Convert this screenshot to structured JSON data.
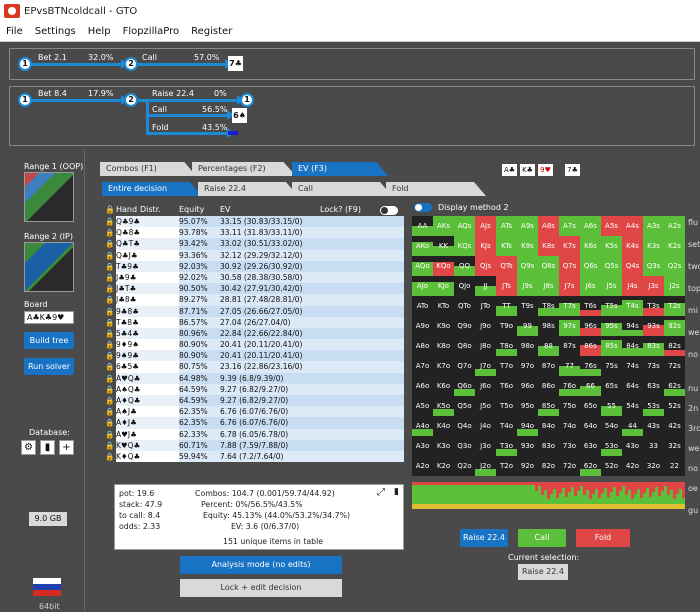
{
  "window": {
    "title": "EPvsBTNcoldcall - GTO"
  },
  "menu": [
    "File",
    "Settings",
    "Help",
    "FlopzillaPro",
    "Register"
  ],
  "tree1": {
    "node_a": "1",
    "bet": "Bet 2.1",
    "bet_pct": "32.0%",
    "node_b": "2",
    "call": "Call",
    "call_pct": "57.0%",
    "card": "7♣"
  },
  "tree2": {
    "node_a": "1",
    "bet": "Bet 8.4",
    "bet_pct": "17.9%",
    "node_b": "2",
    "raise": "Raise 22.4",
    "raise_pct": "0%",
    "node_c": "1",
    "call": "Call",
    "call_pct": "56.5%",
    "call_card": "6♠",
    "fold": "Fold",
    "fold_pct": "43.5%"
  },
  "side": {
    "range1": "Range 1 (OOP)",
    "range2": "Range 2 (IP)",
    "board_label": "Board",
    "board_value": "A♣K♣9♥",
    "build": "Build tree",
    "run": "Run solver",
    "database": "Database:",
    "size": "9.0 GB",
    "bits": "64bit"
  },
  "tabs": {
    "combos": "Combos (F1)",
    "percentages": "Percentages (F2)",
    "ev": "EV (F3)",
    "entire": "Entire decision",
    "raise": "Raise 22.4",
    "call": "Call",
    "fold": "Fold"
  },
  "board_cards": [
    "A♣",
    "K♣",
    "9♥",
    "7♣"
  ],
  "table": {
    "headers": {
      "hand": "Hand",
      "distr": "Distr.",
      "equity": "Equity",
      "ev": "EV",
      "lock": "Lock? (F9)"
    },
    "rows": [
      {
        "hand": "Q♣9♣",
        "equity": "95.07%",
        "ev": "33.15 (30.83/33.15/0)"
      },
      {
        "hand": "Q♣8♣",
        "equity": "93.78%",
        "ev": "33.11 (31.83/33.11/0)"
      },
      {
        "hand": "Q♣T♣",
        "equity": "93.42%",
        "ev": "33.02 (30.51/33.02/0)"
      },
      {
        "hand": "Q♣J♣",
        "equity": "93.36%",
        "ev": "32.12 (29.29/32.12/0)"
      },
      {
        "hand": "T♣9♣",
        "equity": "92.03%",
        "ev": "30.92 (29.26/30.92/0)"
      },
      {
        "hand": "J♣9♣",
        "equity": "92.02%",
        "ev": "30.58 (28.38/30.58/0)"
      },
      {
        "hand": "J♣T♣",
        "equity": "90.50%",
        "ev": "30.42 (27.91/30.42/0)"
      },
      {
        "hand": "J♣8♣",
        "equity": "89.27%",
        "ev": "28.81 (27.48/28.81/0)"
      },
      {
        "hand": "9♣8♣",
        "equity": "87.71%",
        "ev": "27.05 (26.66/27.05/0)"
      },
      {
        "hand": "T♣8♣",
        "equity": "86.57%",
        "ev": "27.04 (26/27.04/0)"
      },
      {
        "hand": "5♣4♣",
        "equity": "80.96%",
        "ev": "22.84 (22.66/22.84/0)"
      },
      {
        "hand": "9♦9♠",
        "equity": "80.90%",
        "ev": "20.41 (20.11/20.41/0)"
      },
      {
        "hand": "9♠9♣",
        "equity": "80.90%",
        "ev": "20.41 (20.11/20.41/0)"
      },
      {
        "hand": "6♣5♣",
        "equity": "80.75%",
        "ev": "23.16 (22.86/23.16/0)"
      },
      {
        "hand": "A♥Q♣",
        "equity": "64.98%",
        "ev": "9.39 (6.8/9.39/0)"
      },
      {
        "hand": "A♠Q♣",
        "equity": "64.59%",
        "ev": "9.27 (6.82/9.27/0)"
      },
      {
        "hand": "A♦Q♣",
        "equity": "64.59%",
        "ev": "9.27 (6.82/9.27/0)"
      },
      {
        "hand": "A♠J♣",
        "equity": "62.35%",
        "ev": "6.76 (6.07/6.76/0)"
      },
      {
        "hand": "A♦J♣",
        "equity": "62.35%",
        "ev": "6.76 (6.07/6.76/0)"
      },
      {
        "hand": "A♥J♣",
        "equity": "62.33%",
        "ev": "6.78 (6.05/6.78/0)"
      },
      {
        "hand": "K♥Q♣",
        "equity": "60.71%",
        "ev": "7.88 (7.59/7.88/0)"
      },
      {
        "hand": "K♦Q♣",
        "equity": "59.94%",
        "ev": "7.64 (7.2/7.64/0)"
      }
    ]
  },
  "stats": {
    "pot": "pot: 19.6",
    "stack": "stack: 47.9",
    "tocall": "to call: 8.4",
    "odds": "odds: 2.33",
    "combos": "Combos: 104.7 (0.001/59.74/44.92)",
    "percent": "Percent: 0%/56.5%/43.5%",
    "equity": "Equity: 45.13% (44.0%/53.2%/34.7%)",
    "ev": "EV: 3.6 (0/6.37/0)",
    "unique": "151 unique items in table"
  },
  "buttons": {
    "analysis": "Analysis mode (no edits)",
    "lock_edit": "Lock + edit decision"
  },
  "display_method": "Display method 2",
  "grid": {
    "ranks": [
      "A",
      "K",
      "Q",
      "J",
      "T",
      "9",
      "8",
      "7",
      "6",
      "5",
      "4",
      "3",
      "2"
    ]
  },
  "actions": {
    "raise": "Raise 22.4",
    "call": "Call",
    "fold": "Fold",
    "current_label": "Current selection:",
    "current_value": "Raise 22.4"
  },
  "right_edge": [
    "flu",
    "set",
    "two",
    "top",
    "mi",
    "we",
    "no",
    "nu",
    "2n",
    "3rc",
    "we",
    "no",
    "oe",
    "gu"
  ],
  "colors": {
    "raise": "#1873c4",
    "call": "#5cbf3a",
    "fold": "#e04646"
  }
}
